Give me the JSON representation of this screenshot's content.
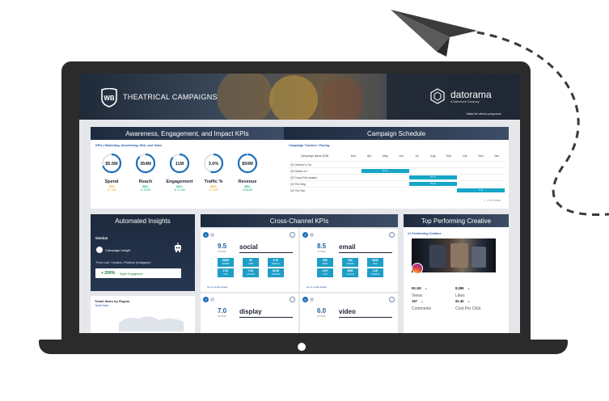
{
  "brand": {
    "title": "THEATRICAL CAMPAIGNS",
    "logo_name": "datorama",
    "logo_sub": "A Salesforce Company",
    "demo_note": "*data for demo purposes"
  },
  "kpis": {
    "header": "Awareness, Engagement, and Impact KPIs",
    "caption": "KPIs | Marketing, Advertising, Web, and Sales",
    "items": [
      {
        "value": "$5.5M",
        "label": "Spend",
        "pct": "70%",
        "target": "of 7.5M",
        "color": "#f0a21a",
        "fill": 0.7
      },
      {
        "value": "354M",
        "label": "Reach",
        "pct": "88%",
        "target": "of 300M",
        "color": "#22b08f",
        "fill": 0.88
      },
      {
        "value": "11M",
        "label": "Engagement",
        "pct": "86%",
        "target": "of 12.5M",
        "color": "#22b08f",
        "fill": 0.86
      },
      {
        "value": "3.0%",
        "label": "Traffic %",
        "pct": "55%",
        "target": "of 3.5%",
        "color": "#f0a21a",
        "fill": 0.55
      },
      {
        "value": "$50M",
        "label": "Revenue",
        "pct": "98%",
        "target": "of $50M",
        "color": "#22b08f",
        "fill": 0.98
      }
    ]
  },
  "schedule": {
    "header": "Campaign Schedule",
    "caption": "Campaign Timeline / Pacing",
    "name_header": "Campaign Name (DB)",
    "months": [
      "Mar",
      "Apr",
      "May",
      "Jun",
      "Jul",
      "Aug",
      "Sep",
      "Oct",
      "Nov",
      "Dec"
    ],
    "rows": [
      {
        "name": "Q1 Director's Cut",
        "bar_label": "",
        "start": 0,
        "span": 0
      },
      {
        "name": "Q2 Desert 4.0",
        "bar_label": "91 %",
        "start": 1,
        "span": 3
      },
      {
        "name": "Q2 Crazy Rich Asians",
        "bar_label": "57 %",
        "start": 4,
        "span": 3
      },
      {
        "name": "Q3 The Meg",
        "bar_label": "55 %",
        "start": 4,
        "span": 3
      },
      {
        "name": "Q4 The Nun",
        "bar_label": "0 %",
        "start": 7,
        "span": 3
      }
    ],
    "pager": "1 - 4 of 4 items"
  },
  "insights": {
    "header": "Automated Insights",
    "genius": "Genius",
    "campaign_insight": "Campaign Insight",
    "first_look": "\"First Look\" Creative | Platform (Instagram)",
    "value": "+ 200%",
    "value_sub": "Higher Engagement"
  },
  "ticket_sales": {
    "title": "Ticket Sales by Region",
    "filter": "Ticket Sales"
  },
  "cross_channel": {
    "header": "Cross-Channel KPIs",
    "cards": [
      {
        "num": "1",
        "big": "9.5",
        "big_sub": "SCORE",
        "channel": "social",
        "tiles": [
          {
            "a": "$98M",
            "b": "SPEND"
          },
          {
            "a": "$0",
            "b": "CPM"
          },
          {
            "a": "5.7K",
            "b": "REACH"
          },
          {
            "a": "3.7K",
            "b": "CTR"
          },
          {
            "a": "7.6K",
            "b": "CLICKS"
          },
          {
            "a": "$2.56",
            "b": "TRAFFIC"
          }
        ],
        "link": "Go to social details"
      },
      {
        "num": "2",
        "big": "8.5",
        "big_sub": "SCORE",
        "channel": "email",
        "tiles": [
          {
            "a": "85K",
            "b": "SENT"
          },
          {
            "a": "25K",
            "b": "OPENS"
          },
          {
            "a": "$30K",
            "b": "REV"
          },
          {
            "a": "3.0%",
            "b": "CTR"
          },
          {
            "a": "960K",
            "b": "CLICKS"
          },
          {
            "a": "1.2K",
            "b": "TRAFFIC"
          }
        ],
        "link": "Go to email details"
      },
      {
        "num": "3",
        "big": "7.0",
        "big_sub": "SCORE",
        "channel": "display",
        "tiles": [],
        "link": ""
      },
      {
        "num": "4",
        "big": "6.0",
        "big_sub": "SCORE",
        "channel": "video",
        "tiles": [],
        "link": ""
      }
    ]
  },
  "top_creative": {
    "header": "Top Performing Creative",
    "caption": "#1 Performing Creative",
    "stats": [
      {
        "value": "50.1M",
        "delta": "▲",
        "label": "Views"
      },
      {
        "value": "8,089",
        "delta": "▲",
        "label": "Likes"
      },
      {
        "value": "167",
        "delta": "▲",
        "label": "Comments"
      },
      {
        "value": "$1.45",
        "delta": "▲",
        "label": "Cost Per Click"
      }
    ]
  }
}
